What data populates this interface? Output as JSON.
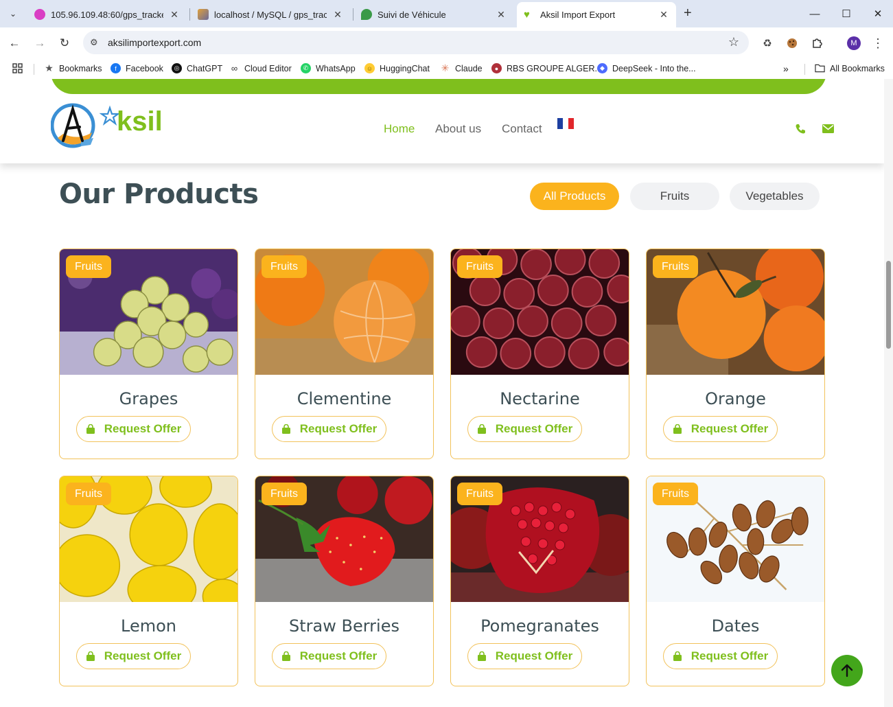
{
  "browser": {
    "tabs": [
      {
        "title": "105.96.109.48:60/gps_tracker/lo",
        "favicon": "pink-circle-icon",
        "color": "#d93ec4"
      },
      {
        "title": "localhost / MySQL / gps_trackin",
        "favicon": "phpmyadmin-icon",
        "color": "#e0a03a"
      },
      {
        "title": "Suivi de Véhicule",
        "favicon": "map-pin-icon",
        "color": "#3a9a48"
      },
      {
        "title": "Aksil Import Export",
        "favicon": "heart-icon",
        "color": "#7fbf1d"
      }
    ],
    "url": "aksilimportexport.com",
    "avatar_letter": "M",
    "bookmarks": [
      {
        "label": "Bookmarks",
        "icon": "star-icon",
        "color": "#555555"
      },
      {
        "label": "Facebook",
        "icon": "facebook-icon",
        "color": "#1877f2"
      },
      {
        "label": "ChatGPT",
        "icon": "chatgpt-icon",
        "color": "#111111"
      },
      {
        "label": "Cloud Editor",
        "icon": "infinity-icon",
        "color": "#333333"
      },
      {
        "label": "WhatsApp",
        "icon": "whatsapp-icon",
        "color": "#25d366"
      },
      {
        "label": "HuggingChat",
        "icon": "hugging-face-icon",
        "color": "#ffcc33"
      },
      {
        "label": "Claude",
        "icon": "claude-icon",
        "color": "#d97757"
      },
      {
        "label": "RBS GROUPE ALGER...",
        "icon": "rbs-icon",
        "color": "#b0303a"
      },
      {
        "label": "DeepSeek - Into the...",
        "icon": "deepseek-icon",
        "color": "#4d6bfe"
      }
    ],
    "all_bookmarks": "All Bookmarks"
  },
  "site": {
    "logo_text": "ksil",
    "logo_letter": "A",
    "nav": {
      "home": "Home",
      "about": "About us",
      "contact": "Contact"
    },
    "brand_green": "#7fbf1d",
    "accent_orange": "#fbb31d"
  },
  "products": {
    "title": "Our Products",
    "filters": [
      "All Products",
      "Fruits",
      "Vegetables"
    ],
    "active_filter": "All Products",
    "request_label": "Request Offer",
    "items": [
      {
        "name": "Grapes",
        "category": "Fruits"
      },
      {
        "name": "Clementine",
        "category": "Fruits"
      },
      {
        "name": "Nectarine",
        "category": "Fruits"
      },
      {
        "name": "Orange",
        "category": "Fruits"
      },
      {
        "name": "Lemon",
        "category": "Fruits"
      },
      {
        "name": "Straw Berries",
        "category": "Fruits"
      },
      {
        "name": "Pomegranates",
        "category": "Fruits"
      },
      {
        "name": "Dates",
        "category": "Fruits"
      }
    ]
  }
}
